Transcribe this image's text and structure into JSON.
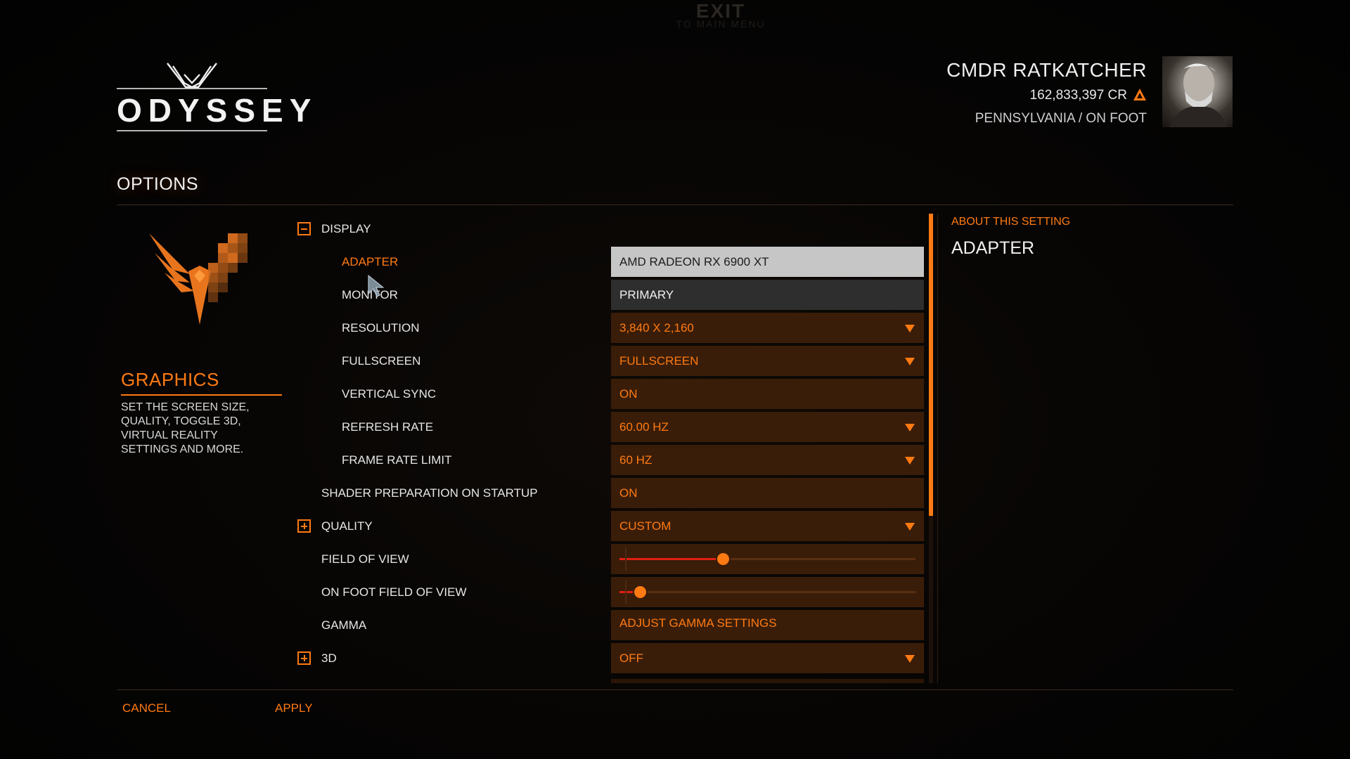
{
  "top": {
    "exit_label": "EXIT",
    "exit_sub": "TO MAIN MENU"
  },
  "logo": {
    "text": "ODYSSEY"
  },
  "commander": {
    "name": "CMDR RATKATCHER",
    "credits": "162,833,397 CR",
    "location": "PENNSYLVANIA / ON FOOT",
    "credits_icon": "rank-triangle-icon"
  },
  "page": {
    "title": "OPTIONS"
  },
  "category": {
    "title": "GRAPHICS",
    "description": "SET THE SCREEN SIZE, QUALITY, TOGGLE 3D, VIRTUAL REALITY SETTINGS AND MORE."
  },
  "settings": {
    "display": {
      "label": "DISPLAY"
    },
    "adapter": {
      "label": "ADAPTER",
      "value": "AMD RADEON RX 6900 XT"
    },
    "monitor": {
      "label": "MONITOR",
      "value": "PRIMARY"
    },
    "resolution": {
      "label": "RESOLUTION",
      "value": "3,840 X 2,160"
    },
    "fullscreen": {
      "label": "FULLSCREEN",
      "value": "FULLSCREEN"
    },
    "vsync": {
      "label": "VERTICAL SYNC",
      "value": "ON"
    },
    "refresh_rate": {
      "label": "REFRESH RATE",
      "value": "60.00 HZ"
    },
    "frame_rate_limit": {
      "label": "FRAME RATE LIMIT",
      "value": "60 HZ"
    },
    "shader_prep": {
      "label": "SHADER PREPARATION ON STARTUP",
      "value": "ON"
    },
    "quality": {
      "label": "QUALITY",
      "value": "CUSTOM"
    },
    "fov": {
      "label": "FIELD OF VIEW",
      "level": 0.35
    },
    "on_foot_fov": {
      "label": "ON FOOT FIELD OF VIEW",
      "level": 0.07
    },
    "gamma": {
      "label": "GAMMA",
      "value": "ADJUST GAMMA SETTINGS"
    },
    "three_d": {
      "label": "3D",
      "value": "OFF"
    }
  },
  "about": {
    "heading": "ABOUT THIS SETTING",
    "title": "ADAPTER"
  },
  "buttons": {
    "cancel": "CANCEL",
    "apply": "APPLY"
  },
  "colors": {
    "accent": "#ff7a12",
    "field_bg": "#3a1d08",
    "slider_fill": "#e01e12"
  }
}
